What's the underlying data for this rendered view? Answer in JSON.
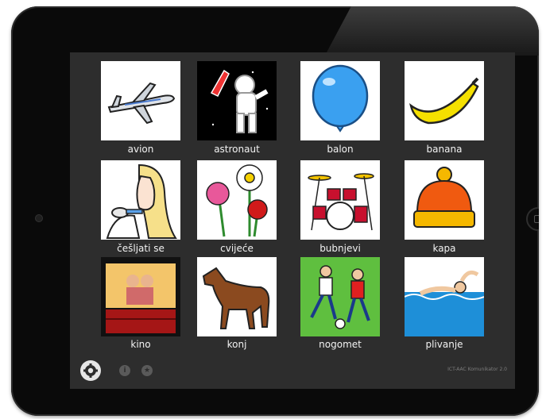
{
  "tiles": [
    {
      "label": "avion",
      "icon": "airplane-icon"
    },
    {
      "label": "astronaut",
      "icon": "astronaut-icon"
    },
    {
      "label": "balon",
      "icon": "balloon-icon"
    },
    {
      "label": "banana",
      "icon": "banana-icon"
    },
    {
      "label": "češljati se",
      "icon": "comb-hair-icon"
    },
    {
      "label": "cvijeće",
      "icon": "flowers-icon"
    },
    {
      "label": "bubnjevi",
      "icon": "drums-icon"
    },
    {
      "label": "kapa",
      "icon": "hat-icon"
    },
    {
      "label": "kino",
      "icon": "cinema-icon"
    },
    {
      "label": "konj",
      "icon": "horse-icon"
    },
    {
      "label": "nogomet",
      "icon": "football-icon"
    },
    {
      "label": "plivanje",
      "icon": "swimming-icon"
    }
  ],
  "footer": {
    "version_text": "ICT-AAC Komunikator 2.0",
    "icons": [
      "gear-icon",
      "info-icon",
      "star-icon"
    ]
  },
  "colors": {
    "screen_bg": "#2d2d2d",
    "tile_bg": "#ffffff",
    "label_text": "#f2f2f2"
  }
}
